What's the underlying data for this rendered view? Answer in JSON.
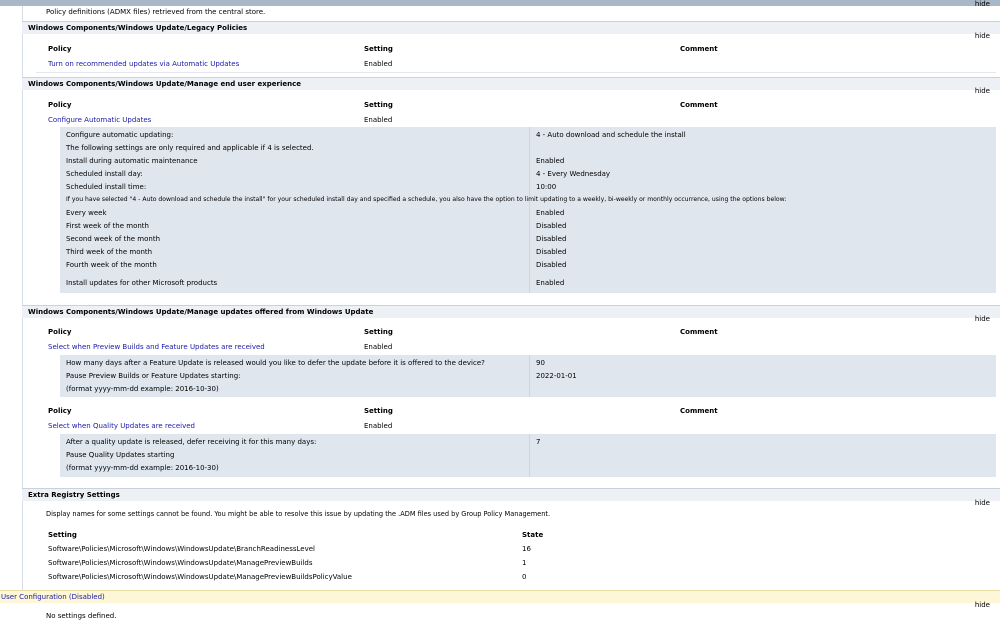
{
  "header": {
    "hide": "hide",
    "admx_note": "Policy definitions (ADMX files) retrieved from the central store."
  },
  "col_headers": {
    "policy": "Policy",
    "setting": "Setting",
    "comment": "Comment",
    "setting_col": "Setting",
    "state": "State"
  },
  "legacy": {
    "title": "Windows Components/Windows Update/Legacy Policies",
    "policy": "Turn on recommended updates via Automatic Updates",
    "value": "Enabled"
  },
  "enduser": {
    "title": "Windows Components/Windows Update/Manage end user experience",
    "policy": "Configure Automatic Updates",
    "value": "Enabled",
    "rows": [
      {
        "label": "Configure automatic updating:",
        "value": "4 - Auto download and schedule the install"
      },
      {
        "label": "The following settings are only required and applicable if 4 is selected.",
        "value": ""
      },
      {
        "label": "Install during automatic maintenance",
        "value": "Enabled"
      },
      {
        "label": "Scheduled install day:",
        "value": "4 - Every Wednesday"
      },
      {
        "label": "Scheduled install time:",
        "value": "10:00"
      },
      {
        "label": "If you have selected \"4 - Auto download and schedule the install\" for your scheduled install day and specified a schedule, you also have the option to limit updating to a weekly, bi-weekly or monthly occurrence, using the options below:",
        "value": ""
      },
      {
        "label": "Every week",
        "value": "Enabled"
      },
      {
        "label": "First week of the month",
        "value": "Disabled"
      },
      {
        "label": "Second week of the month",
        "value": "Disabled"
      },
      {
        "label": "Third week of the month",
        "value": "Disabled"
      },
      {
        "label": "Fourth week of the month",
        "value": "Disabled"
      },
      {
        "label": "Install updates for other Microsoft products",
        "value": "Enabled"
      }
    ]
  },
  "offered": {
    "title": "Windows Components/Windows Update/Manage updates offered from Windows Update",
    "policy1": "Select when Preview Builds and Feature Updates are received",
    "value1": "Enabled",
    "rows1": [
      {
        "label": "How many days after a Feature Update is released would you like to defer the update before it is offered to the device?",
        "value": "90"
      },
      {
        "label": "Pause Preview Builds or Feature Updates starting:",
        "value": "2022-01-01"
      },
      {
        "label": "(format yyyy-mm-dd example: 2016-10-30)",
        "value": ""
      }
    ],
    "policy2": "Select when Quality Updates are received",
    "value2": "Enabled",
    "rows2": [
      {
        "label": "After a quality update is released, defer receiving it for this many days:",
        "value": "7"
      },
      {
        "label": "Pause Quality Updates starting",
        "value": ""
      },
      {
        "label": "(format yyyy-mm-dd example: 2016-10-30)",
        "value": ""
      }
    ]
  },
  "extra": {
    "title": "Extra Registry Settings",
    "note": "Display names for some settings cannot be found. You might be able to resolve this issue by updating the .ADM files used by Group Policy Management.",
    "rows": [
      {
        "setting": "Software\\Policies\\Microsoft\\Windows\\WindowsUpdate\\BranchReadinessLevel",
        "state": "16"
      },
      {
        "setting": "Software\\Policies\\Microsoft\\Windows\\WindowsUpdate\\ManagePreviewBuilds",
        "state": "1"
      },
      {
        "setting": "Software\\Policies\\Microsoft\\Windows\\WindowsUpdate\\ManagePreviewBuildsPolicyValue",
        "state": "0"
      }
    ]
  },
  "user": {
    "title": "User Configuration (Disabled)",
    "none": "No settings defined."
  }
}
